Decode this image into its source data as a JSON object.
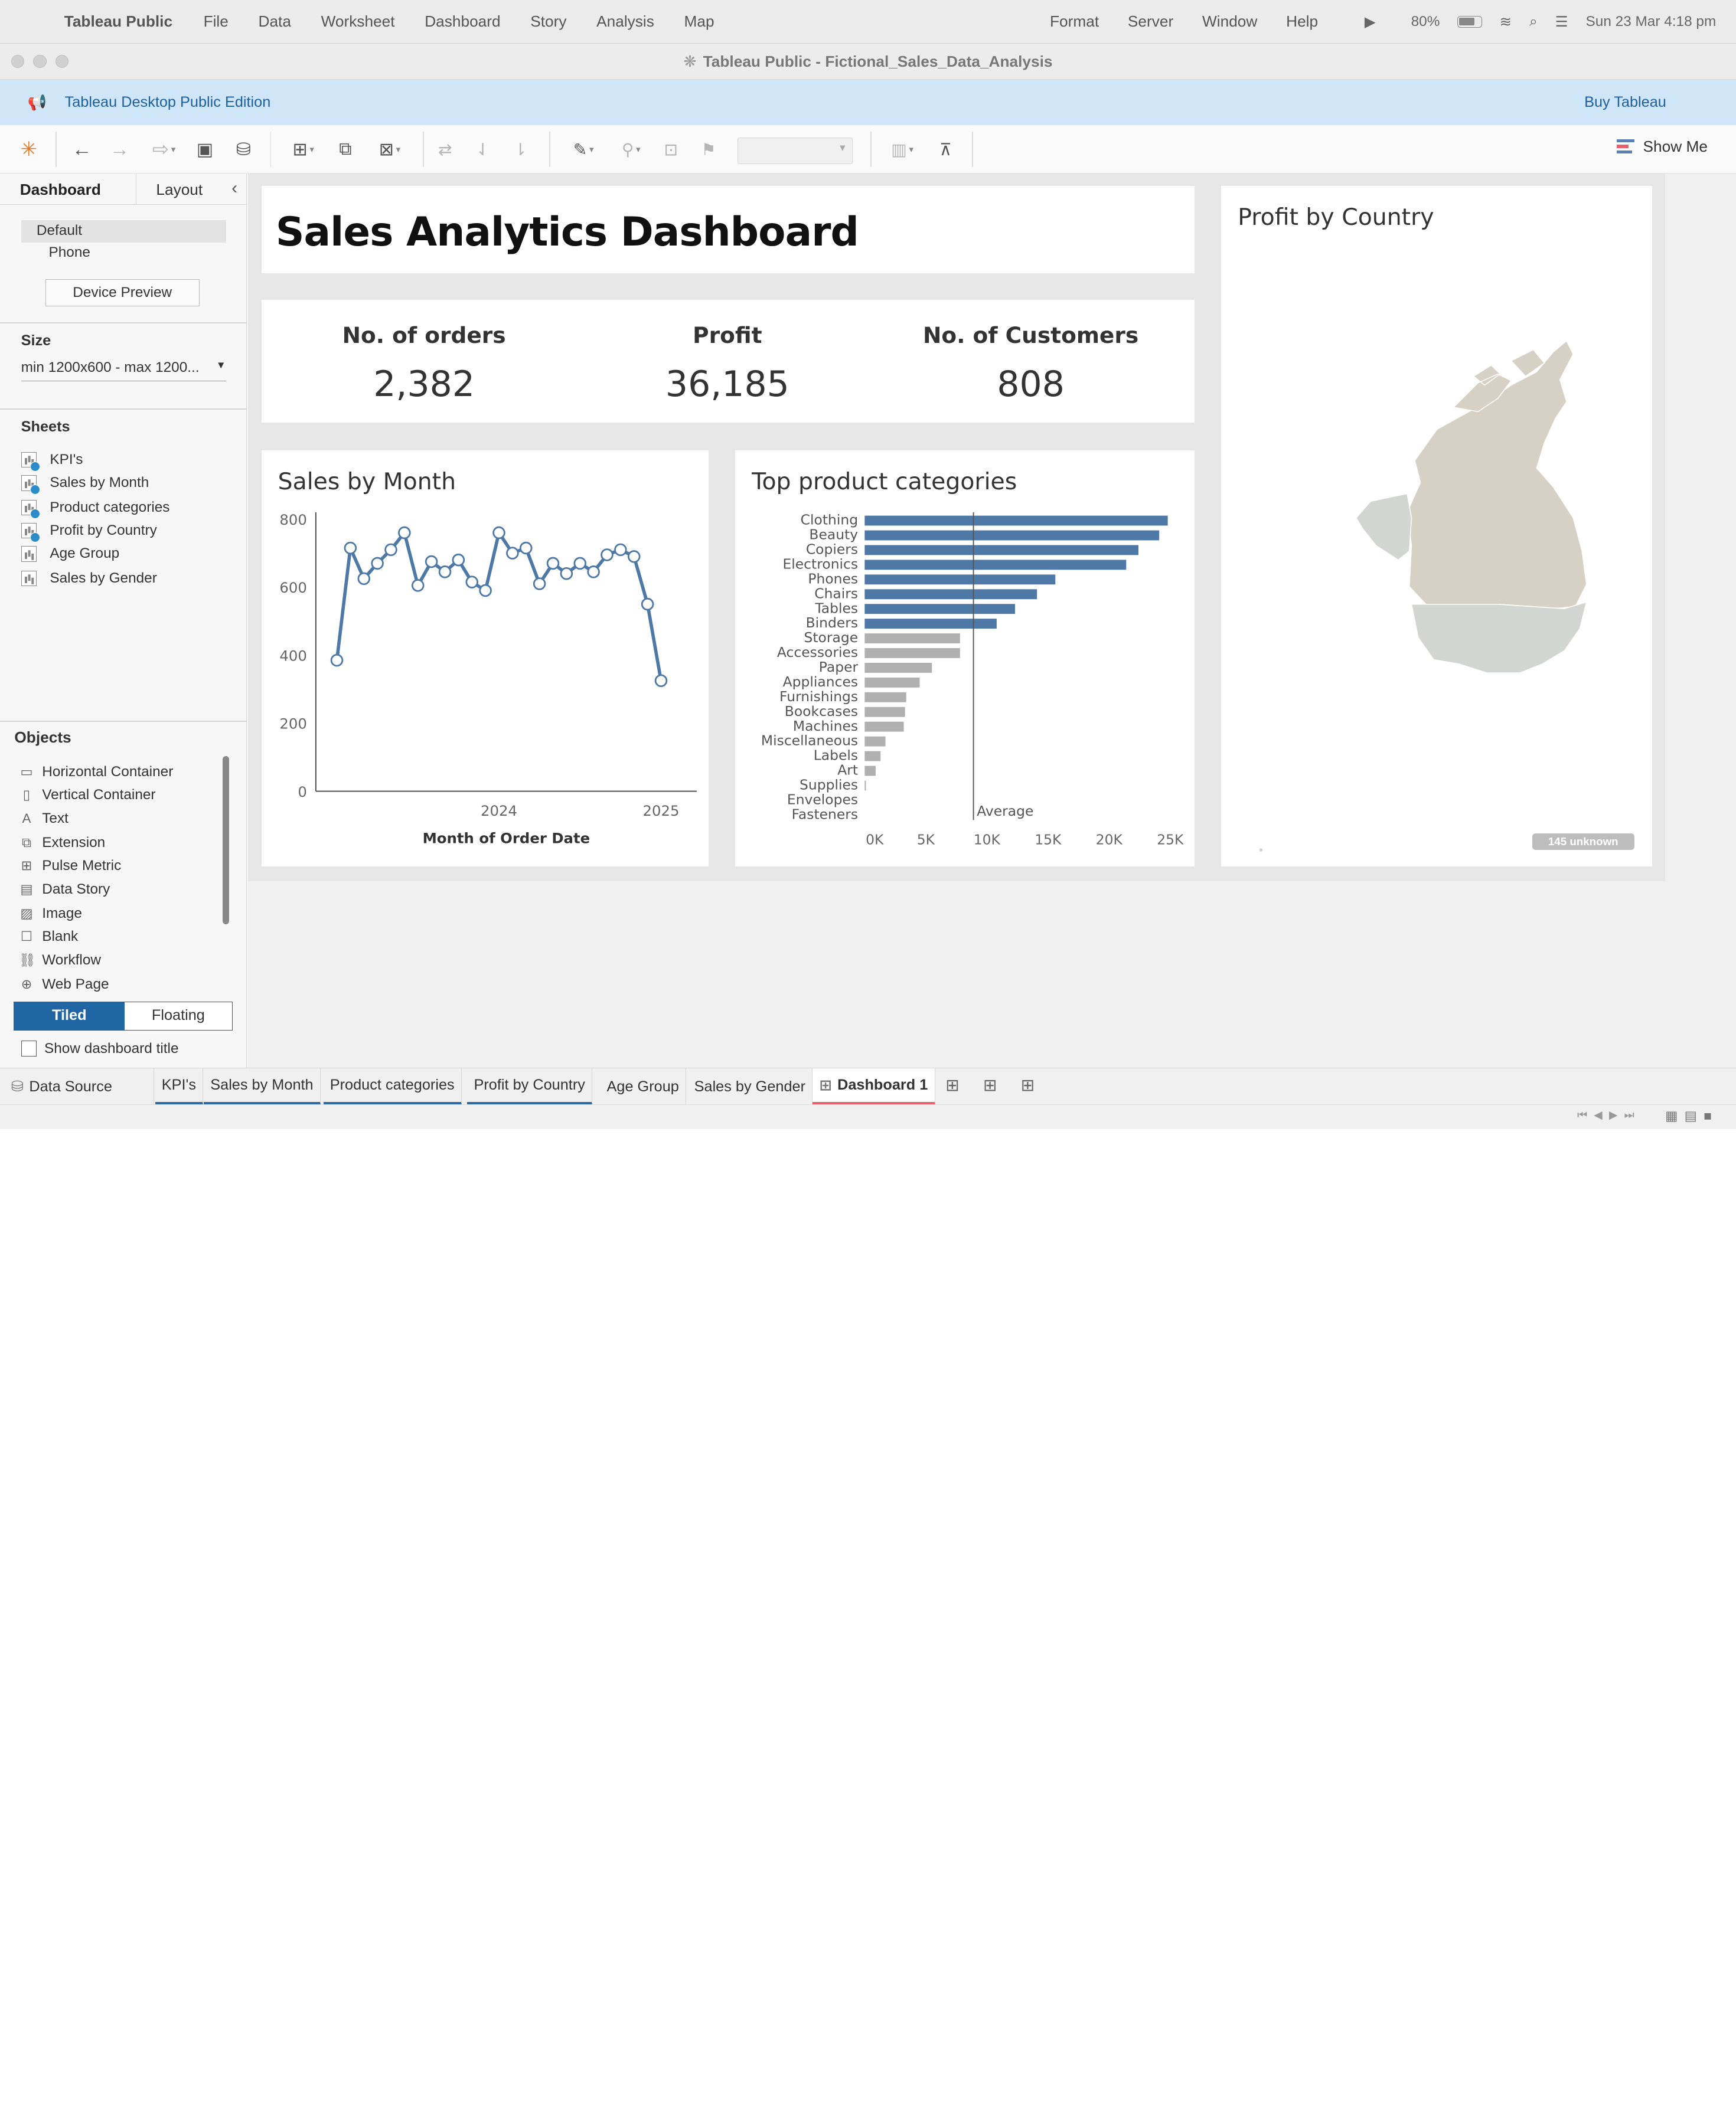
{
  "menubar": {
    "app_name": "Tableau Public",
    "items": [
      "File",
      "Data",
      "Worksheet",
      "Dashboard",
      "Story",
      "Analysis",
      "Map"
    ],
    "right_items": [
      "Format",
      "Server",
      "Window",
      "Help"
    ],
    "battery": "80%",
    "datetime": "Sun 23 Mar  4:18 pm"
  },
  "window": {
    "title": "Tableau Public - Fictional_Sales_Data_Analysis"
  },
  "banner": {
    "edition": "Tableau Desktop Public Edition",
    "buy": "Buy Tableau"
  },
  "toolbar": {
    "show_me": "Show Me"
  },
  "sidebar": {
    "tab_dashboard": "Dashboard",
    "tab_layout": "Layout",
    "device_default": "Default",
    "device_phone": "Phone",
    "device_preview": "Device Preview",
    "size_header": "Size",
    "size_value": "min 1200x600 - max 1200...",
    "sheets_header": "Sheets",
    "sheets": [
      {
        "label": "KPI's",
        "used": true
      },
      {
        "label": "Sales by Month",
        "used": true
      },
      {
        "label": "Product categories",
        "used": true
      },
      {
        "label": "Profit by Country",
        "used": true
      },
      {
        "label": "Age Group",
        "used": false
      },
      {
        "label": "Sales by Gender",
        "used": false
      }
    ],
    "objects_header": "Objects",
    "objects": [
      {
        "label": "Horizontal Container",
        "icon": "horizontal-container-icon"
      },
      {
        "label": "Vertical Container",
        "icon": "vertical-container-icon"
      },
      {
        "label": "Text",
        "icon": "text-icon"
      },
      {
        "label": "Extension",
        "icon": "extension-icon"
      },
      {
        "label": "Pulse Metric",
        "icon": "pulse-metric-icon"
      },
      {
        "label": "Data Story",
        "icon": "data-story-icon"
      },
      {
        "label": "Image",
        "icon": "image-icon"
      },
      {
        "label": "Blank",
        "icon": "blank-icon"
      },
      {
        "label": "Workflow",
        "icon": "workflow-icon"
      },
      {
        "label": "Web Page",
        "icon": "web-page-icon"
      }
    ],
    "tiled": "Tiled",
    "floating": "Floating",
    "show_title": "Show dashboard title"
  },
  "dashboard": {
    "title": "Sales Analytics Dashboard",
    "kpis": [
      {
        "label": "No. of orders",
        "value": "2,382"
      },
      {
        "label": "Profit",
        "value": "36,185"
      },
      {
        "label": "No. of Customers",
        "value": "808"
      }
    ],
    "map": {
      "title": "Profit by Country",
      "unknown": "145 unknown"
    }
  },
  "chart_data": [
    {
      "type": "line",
      "title": "Sales by Month",
      "xlabel": "Month of Order Date",
      "ylabel": "",
      "x": [
        "2023-01",
        "2023-02",
        "2023-03",
        "2023-04",
        "2023-05",
        "2023-06",
        "2023-07",
        "2023-08",
        "2023-09",
        "2023-10",
        "2023-11",
        "2023-12",
        "2024-01",
        "2024-02",
        "2024-03",
        "2024-04",
        "2024-05",
        "2024-06",
        "2024-07",
        "2024-08",
        "2024-09",
        "2024-10",
        "2024-11",
        "2024-12",
        "2025-01",
        "2025-02"
      ],
      "values": [
        385,
        715,
        625,
        670,
        710,
        760,
        605,
        675,
        645,
        680,
        615,
        590,
        760,
        700,
        715,
        610,
        670,
        640,
        670,
        645,
        695,
        710,
        690,
        550,
        325
      ],
      "x_ticks": [
        "2024",
        "2025"
      ],
      "y_ticks": [
        0,
        200,
        400,
        600,
        800
      ],
      "ylim": [
        0,
        820
      ],
      "color": "#4e79a7"
    },
    {
      "type": "bar",
      "orientation": "horizontal",
      "title": "Top product categories",
      "categories": [
        "Clothing",
        "Beauty",
        "Copiers",
        "Electronics",
        "Phones",
        "Chairs",
        "Tables",
        "Binders",
        "Storage",
        "Accessories",
        "Paper",
        "Appliances",
        "Furnishings",
        "Bookcases",
        "Machines",
        "Miscellaneous",
        "Labels",
        "Art",
        "Supplies",
        "Envelopes",
        "Fasteners"
      ],
      "values": [
        24800,
        24100,
        22400,
        21400,
        15600,
        14100,
        12300,
        10800,
        7800,
        7800,
        5500,
        4500,
        3400,
        3300,
        3200,
        1700,
        1300,
        900,
        100,
        0,
        0
      ],
      "x_ticks": [
        "0K",
        "5K",
        "10K",
        "15K",
        "20K",
        "25K"
      ],
      "xlim": [
        0,
        26000
      ],
      "average": 8900,
      "average_label": "Average",
      "color_above": "#4e79a7",
      "color_below": "#b0b0b0"
    }
  ],
  "sheet_tabs": {
    "data_source": "Data Source",
    "tabs": [
      "KPI's",
      "Sales by Month",
      "Product categories",
      "Profit by Country",
      "Age Group",
      "Sales by Gender"
    ],
    "active": "Dashboard 1"
  }
}
